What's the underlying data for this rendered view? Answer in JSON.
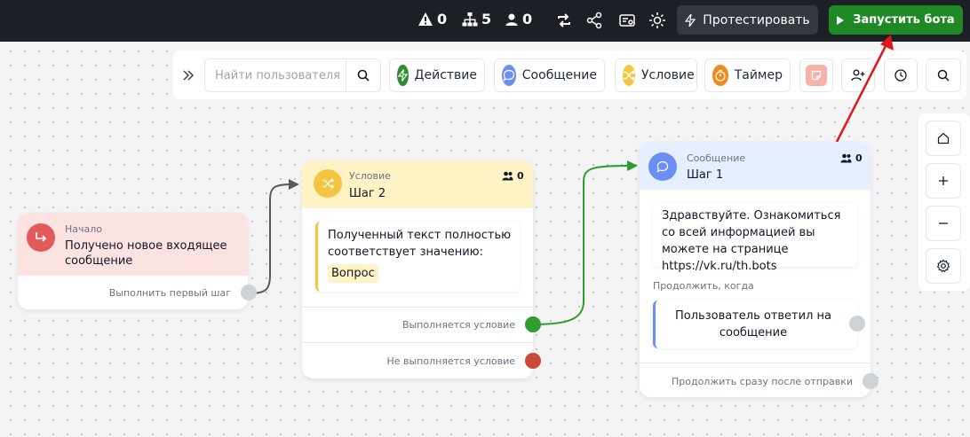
{
  "topbar": {
    "stats": [
      {
        "icon": "warning-icon",
        "value": "0"
      },
      {
        "icon": "hierarchy-icon",
        "value": "5"
      },
      {
        "icon": "user-icon",
        "value": "0"
      }
    ],
    "test_label": "Протестировать",
    "run_label": "Запустить бота"
  },
  "toolbar": {
    "search_placeholder": "Найти пользователя",
    "tools": [
      {
        "label": "Действие",
        "icon": "lightning-icon",
        "color": "#2e8b2e"
      },
      {
        "label": "Сообщение",
        "icon": "chat-bubble-icon",
        "color": "#6b8ff5"
      },
      {
        "label": "Условие",
        "icon": "shuffle-icon",
        "color": "#f5c542"
      },
      {
        "label": "Таймер",
        "icon": "timer-icon",
        "color": "#f08a1a"
      }
    ]
  },
  "nodes": {
    "start": {
      "type": "Начало",
      "title": "Получено новое входящее сообщение",
      "out": "Выполнить первый шаг",
      "accent": "#fde2e2"
    },
    "condition": {
      "type": "Условие",
      "title": "Шаг 2",
      "count": "0",
      "rule": "Полученный текст полностью соответствует значению:",
      "value": "Вопрос",
      "out_true": "Выполняется условие",
      "out_false": "Не выполняется условие",
      "accent": "#fdf3c4"
    },
    "message": {
      "type": "Сообщение",
      "title": "Шаг 1",
      "count": "0",
      "text": "Здравствуйте. Ознакомиться со всей информацией вы можете на странице https://vk.ru/th.bots",
      "continue_label": "Продолжить, когда",
      "trigger": "Пользователь ответил на сообщение",
      "out_after": "Продолжить сразу после отправки",
      "accent": "#e6efff"
    }
  },
  "colors": {
    "green": "#2e9e2e",
    "red": "#c94a35",
    "grey_port": "#cfd2d6",
    "arrow": "#e0161a"
  }
}
